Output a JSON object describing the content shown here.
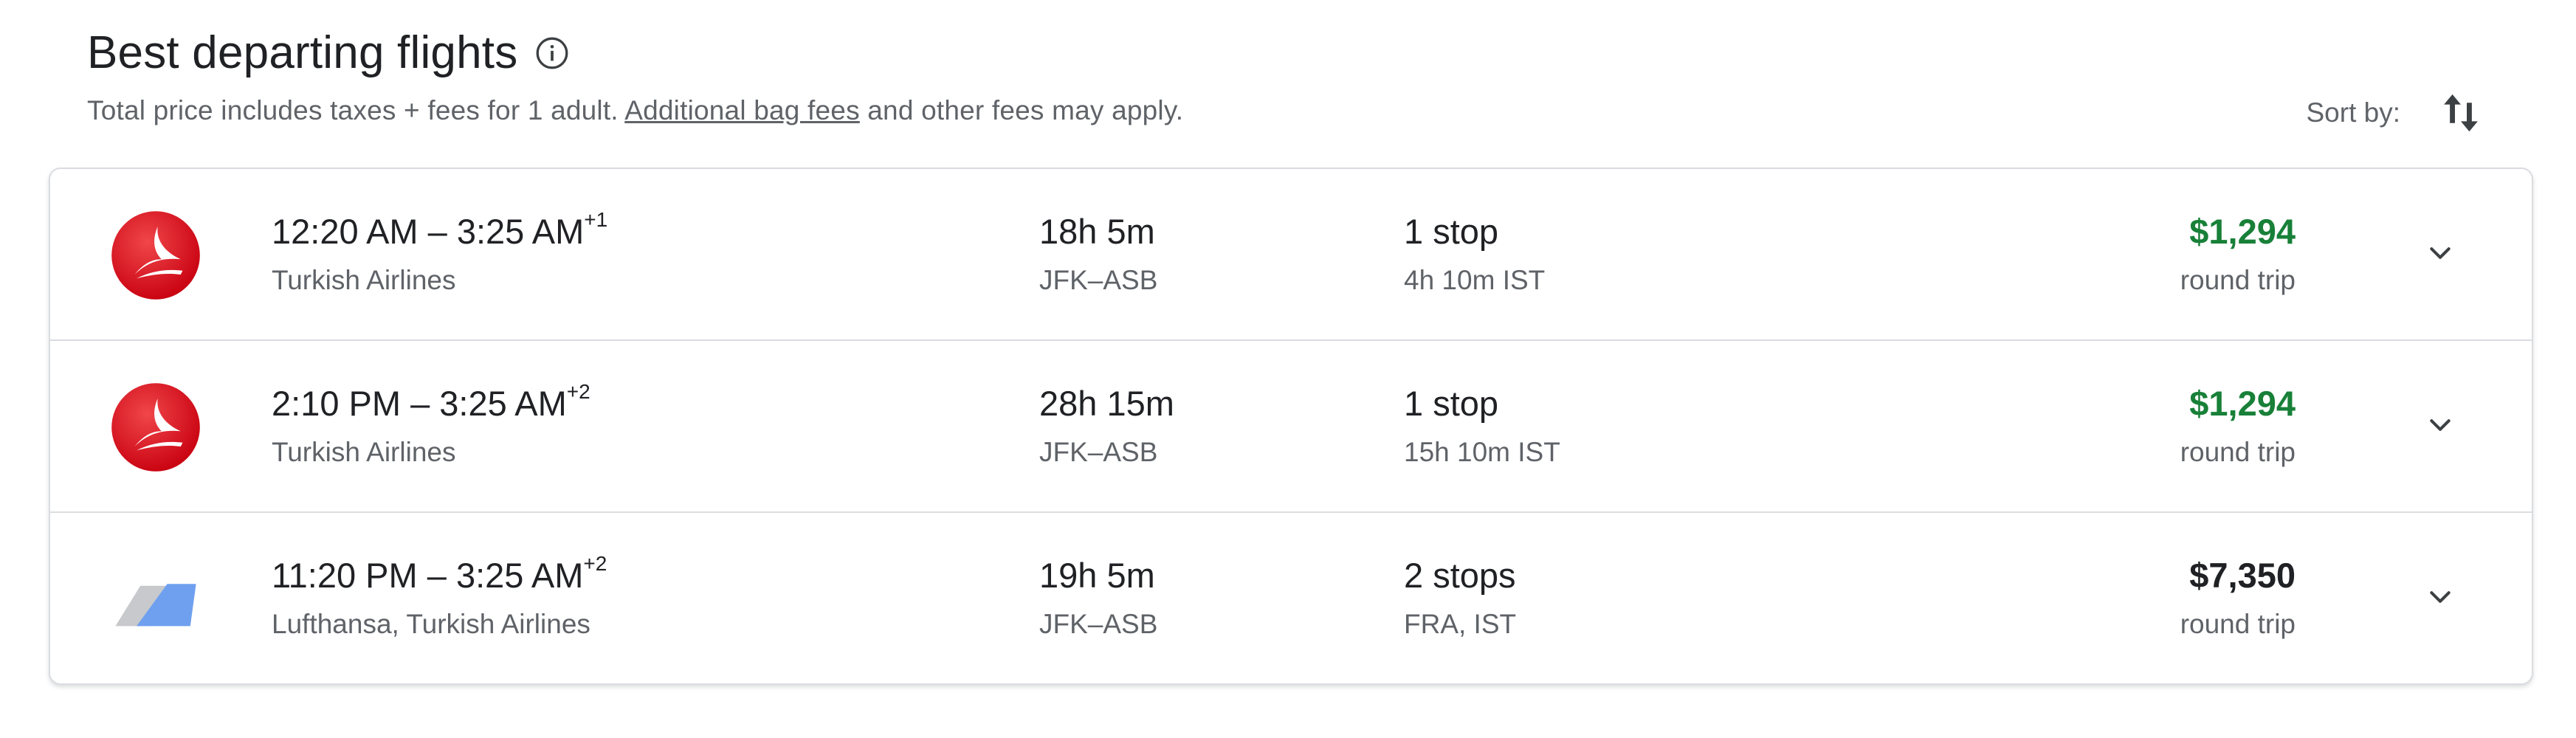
{
  "header": {
    "title": "Best departing flights",
    "subtitle_pre": "Total price includes taxes + fees for 1 adult. ",
    "subtitle_link": "Additional bag fees",
    "subtitle_post": " and other fees may apply."
  },
  "sort": {
    "label": "Sort by:",
    "icon": "sort-icon"
  },
  "colors": {
    "price_green": "#188038",
    "text_primary": "#202124",
    "text_secondary": "#5f6368",
    "turkish_red": "#e30a17",
    "lufthansa_blue": "#6fa0f0"
  },
  "flights": [
    {
      "times": "12:20 AM – 3:25 AM",
      "day_offset": "+1",
      "airline": "Turkish Airlines",
      "duration": "18h 5m",
      "route": "JFK–ASB",
      "stops": "1 stop",
      "layover": "4h 10m IST",
      "price": "$1,294",
      "price_note": "round trip",
      "logo": "turkish-airlines-logo"
    },
    {
      "times": "2:10 PM – 3:25 AM",
      "day_offset": "+2",
      "airline": "Turkish Airlines",
      "duration": "28h 15m",
      "route": "JFK–ASB",
      "stops": "1 stop",
      "layover": "15h 10m IST",
      "price": "$1,294",
      "price_note": "round trip",
      "logo": "turkish-airlines-logo"
    },
    {
      "times": "11:20 PM – 3:25 AM",
      "day_offset": "+2",
      "airline": "Lufthansa, Turkish Airlines",
      "duration": "19h 5m",
      "route": "JFK–ASB",
      "stops": "2 stops",
      "layover": "FRA, IST",
      "price": "$7,350",
      "price_note": "round trip",
      "logo": "multi-airline-tail-logo"
    }
  ]
}
